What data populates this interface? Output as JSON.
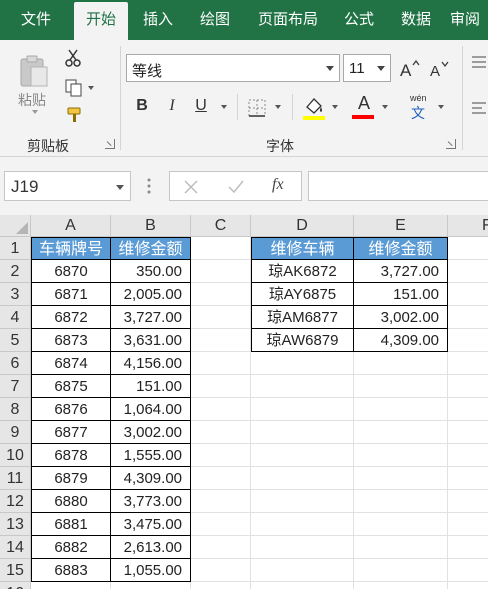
{
  "ribbon_tabs": [
    "文件",
    "开始",
    "插入",
    "绘图",
    "页面布局",
    "公式",
    "数据",
    "审阅"
  ],
  "active_tab": "开始",
  "clipboard": {
    "paste_label": "粘贴",
    "group_label": "剪贴板"
  },
  "font": {
    "name": "等线",
    "size": "11",
    "bold": "B",
    "italic": "I",
    "underline": "U",
    "font_color_glyph": "A",
    "phonetic_top": "wén",
    "phonetic_bottom": "文",
    "group_label": "字体",
    "highlight_color": "#ffff00",
    "font_color": "#ff0000"
  },
  "formula_bar": {
    "name_box": "J19",
    "formula": "",
    "fx": "fx"
  },
  "columns": [
    "A",
    "B",
    "C",
    "D",
    "E",
    "F"
  ],
  "rows": [
    "1",
    "2",
    "3",
    "4",
    "5",
    "6",
    "7",
    "8",
    "9",
    "10",
    "11",
    "12",
    "13",
    "14",
    "15",
    "16"
  ],
  "table1": {
    "headers": [
      "车辆牌号",
      "维修金额"
    ],
    "rows": [
      [
        "6870",
        "350.00"
      ],
      [
        "6871",
        "2,005.00"
      ],
      [
        "6872",
        "3,727.00"
      ],
      [
        "6873",
        "3,631.00"
      ],
      [
        "6874",
        "4,156.00"
      ],
      [
        "6875",
        "151.00"
      ],
      [
        "6876",
        "1,064.00"
      ],
      [
        "6877",
        "3,002.00"
      ],
      [
        "6878",
        "1,555.00"
      ],
      [
        "6879",
        "4,309.00"
      ],
      [
        "6880",
        "3,773.00"
      ],
      [
        "6881",
        "3,475.00"
      ],
      [
        "6882",
        "2,613.00"
      ],
      [
        "6883",
        "1,055.00"
      ]
    ]
  },
  "table2": {
    "headers": [
      "维修车辆",
      "维修金额"
    ],
    "rows": [
      [
        "琼AK6872",
        "3,727.00"
      ],
      [
        "琼AY6875",
        "151.00"
      ],
      [
        "琼AM6877",
        "3,002.00"
      ],
      [
        "琼AW6879",
        "4,309.00"
      ]
    ]
  },
  "colors": {
    "excel_green": "#217346",
    "table_header_blue": "#5b9bd5"
  }
}
